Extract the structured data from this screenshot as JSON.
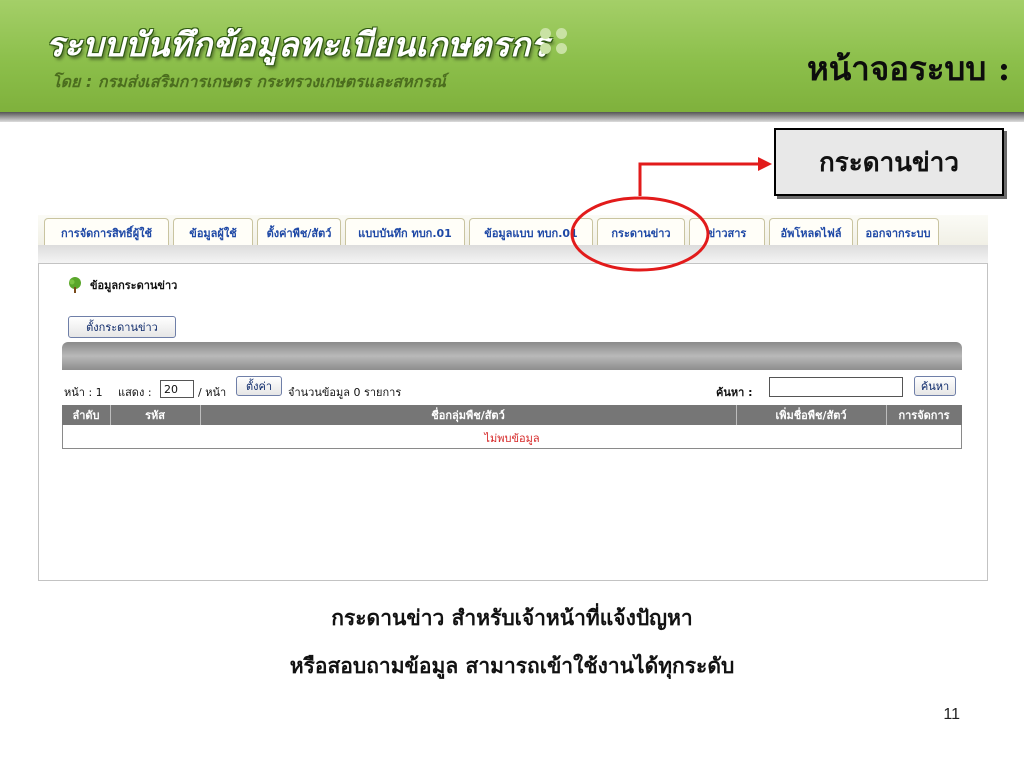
{
  "header": {
    "app_title": "ระบบบันทึกข้อมูลทะเบียนเกษตรกร",
    "subtitle": "โดย : กรมส่งเสริมการเกษตร กระทรวงเกษตรและสหกรณ์",
    "page_heading": "หน้าจอระบบ :"
  },
  "callout": {
    "label": "กระดานข่าว"
  },
  "nav": {
    "tabs": [
      {
        "label": "การจัดการสิทธิ์ผู้ใช้"
      },
      {
        "label": "ข้อมูลผู้ใช้"
      },
      {
        "label": "ตั้งค่าพืช/สัตว์"
      },
      {
        "label": "แบบบันทึก ทบก.01"
      },
      {
        "label": "ข้อมูลแบบ ทบก.01"
      },
      {
        "label": "กระดานข่าว"
      },
      {
        "label": "ข่าวสาร"
      },
      {
        "label": "อัพโหลดไฟล์"
      },
      {
        "label": "ออกจากระบบ"
      }
    ],
    "active_tab": "กระดานข่าว"
  },
  "panel": {
    "section_title": "ข้อมูลกระดานข่าว",
    "new_board_button": "ตั้งกระดานข่าว",
    "pager": {
      "page_label": "หน้า : 1",
      "show_label": "แสดง :",
      "per_page_value": "20",
      "per_page_suffix": "/ หน้า",
      "set_button": "ตั้งค่า",
      "count_text": "จำนวนข้อมูล 0 รายการ",
      "search_label": "ค้นหา :",
      "search_value": "",
      "search_button": "ค้นหา"
    },
    "table": {
      "columns": [
        "ลำดับ",
        "รหัส",
        "ชื่อกลุ่มพืช/สัตว์",
        "เพิ่มชื่อพืช/สัตว์",
        "การจัดการ"
      ],
      "empty_message": "ไม่พบข้อมูล"
    }
  },
  "caption": {
    "line1": "กระดานข่าว สำหรับเจ้าหน้าที่แจ้งปัญหา",
    "line2": "หรือสอบถามข้อมูล สามารถเข้าใช้งานได้ทุกระดับ"
  },
  "slide_number": "11",
  "colors": {
    "banner_green": "#8cbf4b",
    "tab_text": "#1f49a6",
    "annotation_red": "#e21b1b",
    "empty_text": "#d62828"
  }
}
